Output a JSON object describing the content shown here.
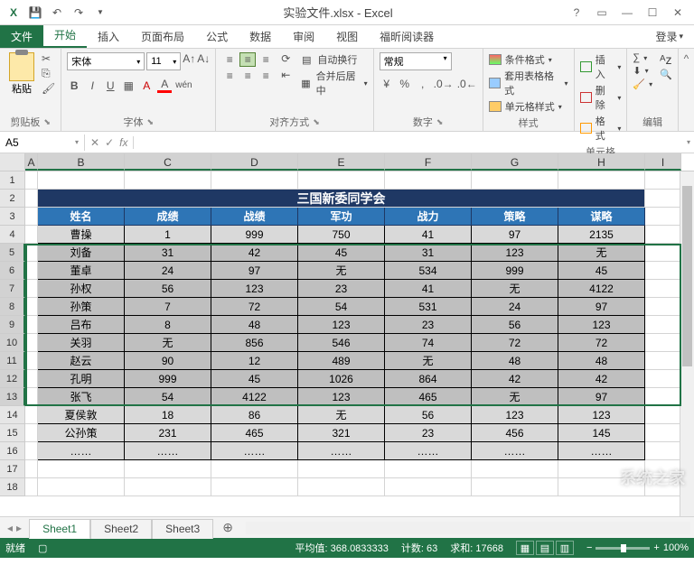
{
  "title": "实验文件.xlsx - Excel",
  "tabs": {
    "file": "文件",
    "home": "开始",
    "insert": "插入",
    "layout": "页面布局",
    "formula": "公式",
    "data": "数据",
    "review": "审阅",
    "view": "视图",
    "foxit": "福昕阅读器",
    "login": "登录"
  },
  "ribbon": {
    "clipboard": {
      "paste": "粘贴",
      "label": "剪贴板"
    },
    "font": {
      "name": "宋体",
      "size": "11",
      "label": "字体"
    },
    "align": {
      "wrap": "自动换行",
      "merge": "合并后居中",
      "label": "对齐方式"
    },
    "number": {
      "category": "常规",
      "label": "数字"
    },
    "styles": {
      "cond": "条件格式",
      "table": "套用表格格式",
      "cell": "单元格样式",
      "label": "样式"
    },
    "cells": {
      "insert": "插入",
      "delete": "删除",
      "format": "格式",
      "label": "单元格"
    },
    "editing": {
      "label": "编辑"
    }
  },
  "namebox": "A5",
  "colWidths": {
    "A": 14,
    "B": 96,
    "C": 96,
    "D": 96,
    "E": 96,
    "F": 96,
    "G": 96,
    "H": 96,
    "I": 40
  },
  "cols": [
    "A",
    "B",
    "C",
    "D",
    "E",
    "F",
    "G",
    "H",
    "I"
  ],
  "tableTitle": "三国新委同学会",
  "headers": [
    "姓名",
    "成绩",
    "战绩",
    "军功",
    "战力",
    "策略",
    "谋略"
  ],
  "dataRows": [
    [
      "曹操",
      "1",
      "999",
      "750",
      "41",
      "97",
      "2135"
    ],
    [
      "刘备",
      "31",
      "42",
      "45",
      "31",
      "123",
      "无"
    ],
    [
      "董卓",
      "24",
      "97",
      "无",
      "534",
      "999",
      "45"
    ],
    [
      "孙权",
      "56",
      "123",
      "23",
      "41",
      "无",
      "4122"
    ],
    [
      "孙策",
      "7",
      "72",
      "54",
      "531",
      "24",
      "97"
    ],
    [
      "吕布",
      "8",
      "48",
      "123",
      "23",
      "56",
      "123"
    ],
    [
      "关羽",
      "无",
      "856",
      "546",
      "74",
      "72",
      "72"
    ],
    [
      "赵云",
      "90",
      "12",
      "489",
      "无",
      "48",
      "48"
    ],
    [
      "孔明",
      "999",
      "45",
      "1026",
      "864",
      "42",
      "42"
    ],
    [
      "张飞",
      "54",
      "4122",
      "123",
      "465",
      "无",
      "97"
    ],
    [
      "夏侯敦",
      "18",
      "86",
      "无",
      "56",
      "123",
      "123"
    ],
    [
      "公孙策",
      "231",
      "465",
      "321",
      "23",
      "456",
      "145"
    ],
    [
      "……",
      "……",
      "……",
      "……",
      "……",
      "……",
      "……"
    ]
  ],
  "sheets": [
    "Sheet1",
    "Sheet2",
    "Sheet3"
  ],
  "status": {
    "ready": "就绪",
    "avgLabel": "平均值:",
    "avg": "368.0833333",
    "countLabel": "计数:",
    "count": "63",
    "sumLabel": "求和:",
    "sum": "17668",
    "zoom": "100%"
  },
  "watermark": "系统之家"
}
